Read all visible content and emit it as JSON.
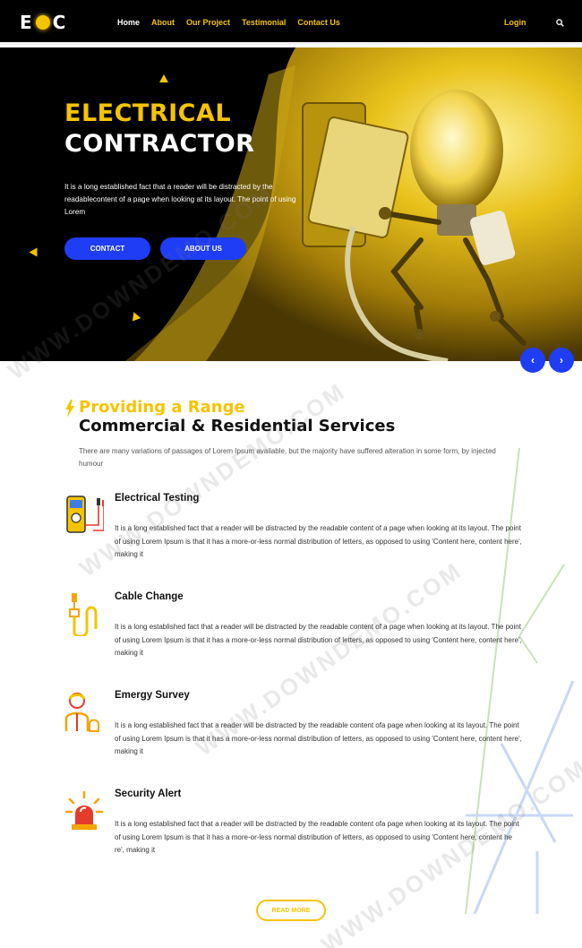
{
  "nav": {
    "logo": "E C",
    "items": [
      "Home",
      "About",
      "Our Project",
      "Testimonial",
      "Contact Us"
    ],
    "login": "Login"
  },
  "hero": {
    "title_line1": "ELECTRICAL",
    "title_line2": "CONTRACTOR",
    "text": "It is a long established fact that a reader will be distracted by the readablecontent of a page when looking at its layout. The point of using Lorem",
    "btn_contact": "CONTACT",
    "btn_about": "ABOUT US",
    "prev": "‹",
    "next": "›"
  },
  "services": {
    "subheading": "Providing a Range",
    "heading": "Commercial & Residential Services",
    "intro": "There are many variations of passages of Lorem Ipsum available, but the majority have suffered alteration in some form, by injected humour",
    "items": [
      {
        "title": "Electrical Testing",
        "text": "It is a long established fact that a reader will be distracted by the readable content of a page when looking at its layout. The point of using Lorem Ipsum is that it has a more-or-less normal distribution of letters, as opposed to using 'Content here, content here', making it"
      },
      {
        "title": "Cable Change",
        "text": "It is a long established fact that a reader will be distracted by the readable content of a page when looking at its layout. The point of using Lorem Ipsum is that it has a more-or-less normal distribution of letters, as opposed to using 'Content here, content here', making it"
      },
      {
        "title": "Emergy Survey",
        "text": "It is a long established fact that a reader will be distracted by the readable content ofa page when looking at its layout. The point of using Lorem Ipsum is that it has a more-or-less normal distribution of letters, as opposed to using 'Content here, content here', making it"
      },
      {
        "title": "Security Alert",
        "text": "It is a long established fact that a reader will be distracted by the readable content ofa page when looking at its layout. The point of using Lorem Ipsum is that it has a more-or-less normal distribution of letters, as opposed to using 'Content here, content he re', making it"
      }
    ],
    "read_more": "READ MORE"
  },
  "watermark": "WWW.DOWNDEMO.COM",
  "colors": {
    "accent": "#f5c400",
    "primary_blue": "#1e3df5",
    "dark": "#000000"
  },
  "icons": [
    "search-icon",
    "lightning-bolt-icon",
    "multimeter-icon",
    "cable-plug-icon",
    "worker-icon",
    "alarm-siren-icon",
    "chevron-left-icon",
    "chevron-right-icon"
  ]
}
